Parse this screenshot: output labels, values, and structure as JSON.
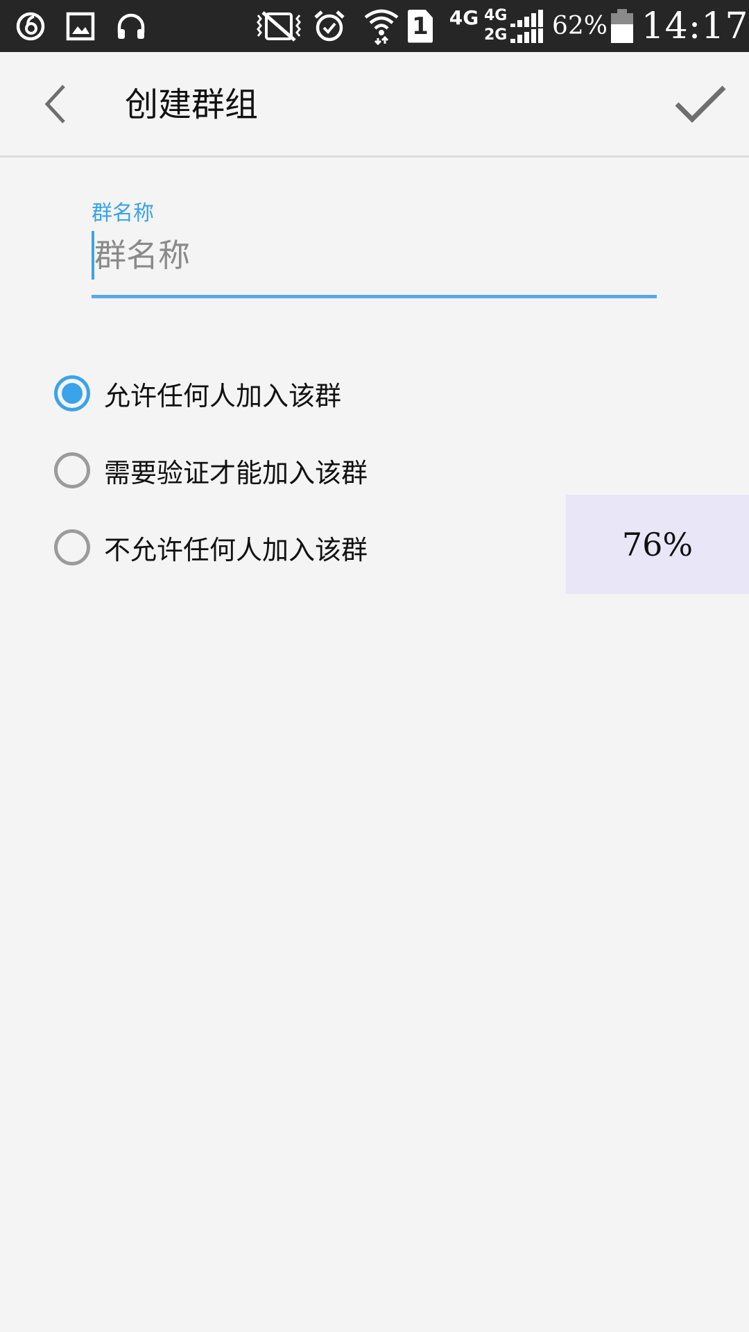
{
  "status_bar": {
    "left_icons": [
      "netease-music-icon",
      "gallery-icon",
      "headphones-icon"
    ],
    "right_icons": [
      "vibrate-mute-icon",
      "alarm-icon",
      "wifi-icon",
      "sim-1-icon",
      "signal-4g-icon",
      "signal-4g-2g-icon",
      "battery-icon"
    ],
    "network_4g": "4G",
    "network_4g_second": "4G",
    "network_2g": "2G",
    "sim_slot": "1",
    "battery_percent": "62%",
    "battery_level": 0.62,
    "time": "14:17"
  },
  "toolbar": {
    "back_icon": "chevron-left-icon",
    "title": "创建群组",
    "confirm_icon": "checkmark-icon"
  },
  "form": {
    "group_name_label": "群名称",
    "group_name_placeholder": "群名称",
    "group_name_value": ""
  },
  "join_options": [
    {
      "label": "允许任何人加入该群",
      "checked": true
    },
    {
      "label": "需要验证才能加入该群",
      "checked": false
    },
    {
      "label": "不允许任何人加入该群",
      "checked": false
    }
  ],
  "progress_overlay": {
    "text": "76%"
  },
  "colors": {
    "accent": "#3aa3ea",
    "status_bar_bg": "#262626",
    "page_bg": "#f4f4f4",
    "radio_unchecked": "#9b9b9b",
    "overlay_bg": "#e8e6f7"
  }
}
